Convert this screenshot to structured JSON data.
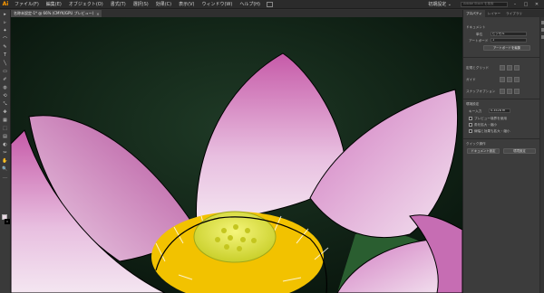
{
  "menubar": {
    "logo": "Ai",
    "items": [
      "ファイル(F)",
      "編集(E)",
      "オブジェクト(O)",
      "書式(T)",
      "選択(S)",
      "効果(C)",
      "表示(V)",
      "ウィンドウ(W)",
      "ヘルプ(H)"
    ],
    "workspace": "初期設定 ⌄",
    "search_placeholder": "Adobe Stock を検索",
    "window_buttons": [
      "–",
      "□",
      "✕"
    ]
  },
  "document": {
    "tab_label": "名称未設定-1* @ 66% (CMYK/GPU プレビュー)",
    "close": "✕"
  },
  "toolbar": {
    "tools": [
      "▸",
      "▹",
      "✦",
      "⌒",
      "✎",
      "T",
      "╲",
      "▭",
      "✐",
      "◍",
      "⟲",
      "⤡",
      "✥",
      "▦",
      "⬚",
      "▤",
      "◐",
      "✂",
      "✋",
      "🔍",
      "…"
    ],
    "fill_color": "#e8d6e2",
    "stroke_color": "#000000"
  },
  "panel": {
    "tabs": [
      "プロパティ",
      "レイヤー",
      "ライブラリ"
    ],
    "section_title": "ドキュメント",
    "units_label": "単位",
    "units_value": "ピクセル",
    "artboard_label": "アートボード",
    "artboard_value": "1",
    "edit_artboard_btn": "アートボードを編集",
    "ruler_grid_label": "定規とグリッド",
    "guides_label": "ガイド",
    "snap_label": "スナップオプション",
    "preferences_title": "環境設定",
    "key_increment_label": "キー入力",
    "key_increment_value": "0.3528 m",
    "check1": "プレビュー境界を使用",
    "check2": "角を拡大・縮小",
    "check3": "線幅と効果も拡大・縮小",
    "quick_actions_title": "クイック操作",
    "doc_settings_btn": "ドキュメント設定",
    "preferences_btn": "環境設定"
  }
}
